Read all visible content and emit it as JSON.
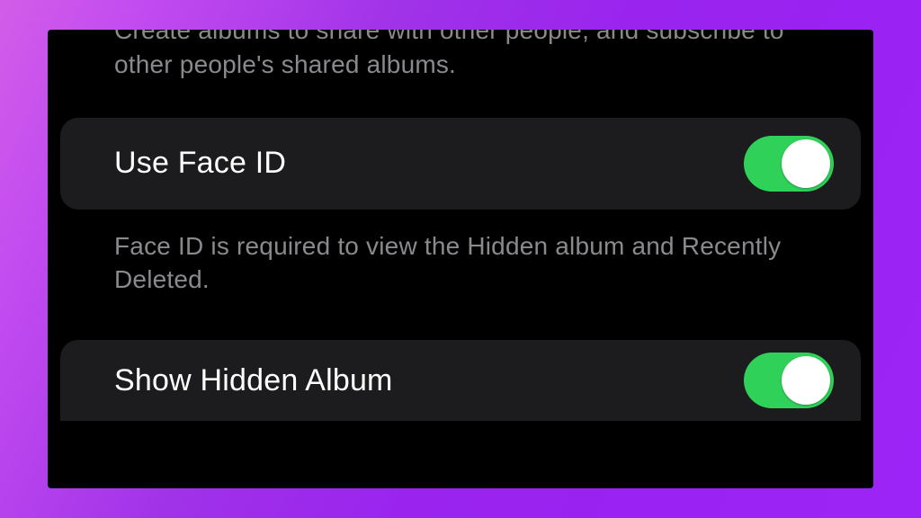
{
  "colors": {
    "toggle_on": "#30d158",
    "cell_bg": "#1c1c1e",
    "footer_text": "#8a8a8e"
  },
  "sharedAlbums": {
    "footer": "Create albums to share with other people, and subscribe to other people's shared albums."
  },
  "faceId": {
    "label": "Use Face ID",
    "on": true,
    "footer": "Face ID is required to view the Hidden album and Recently Deleted."
  },
  "hiddenAlbum": {
    "label": "Show Hidden Album",
    "on": true
  }
}
